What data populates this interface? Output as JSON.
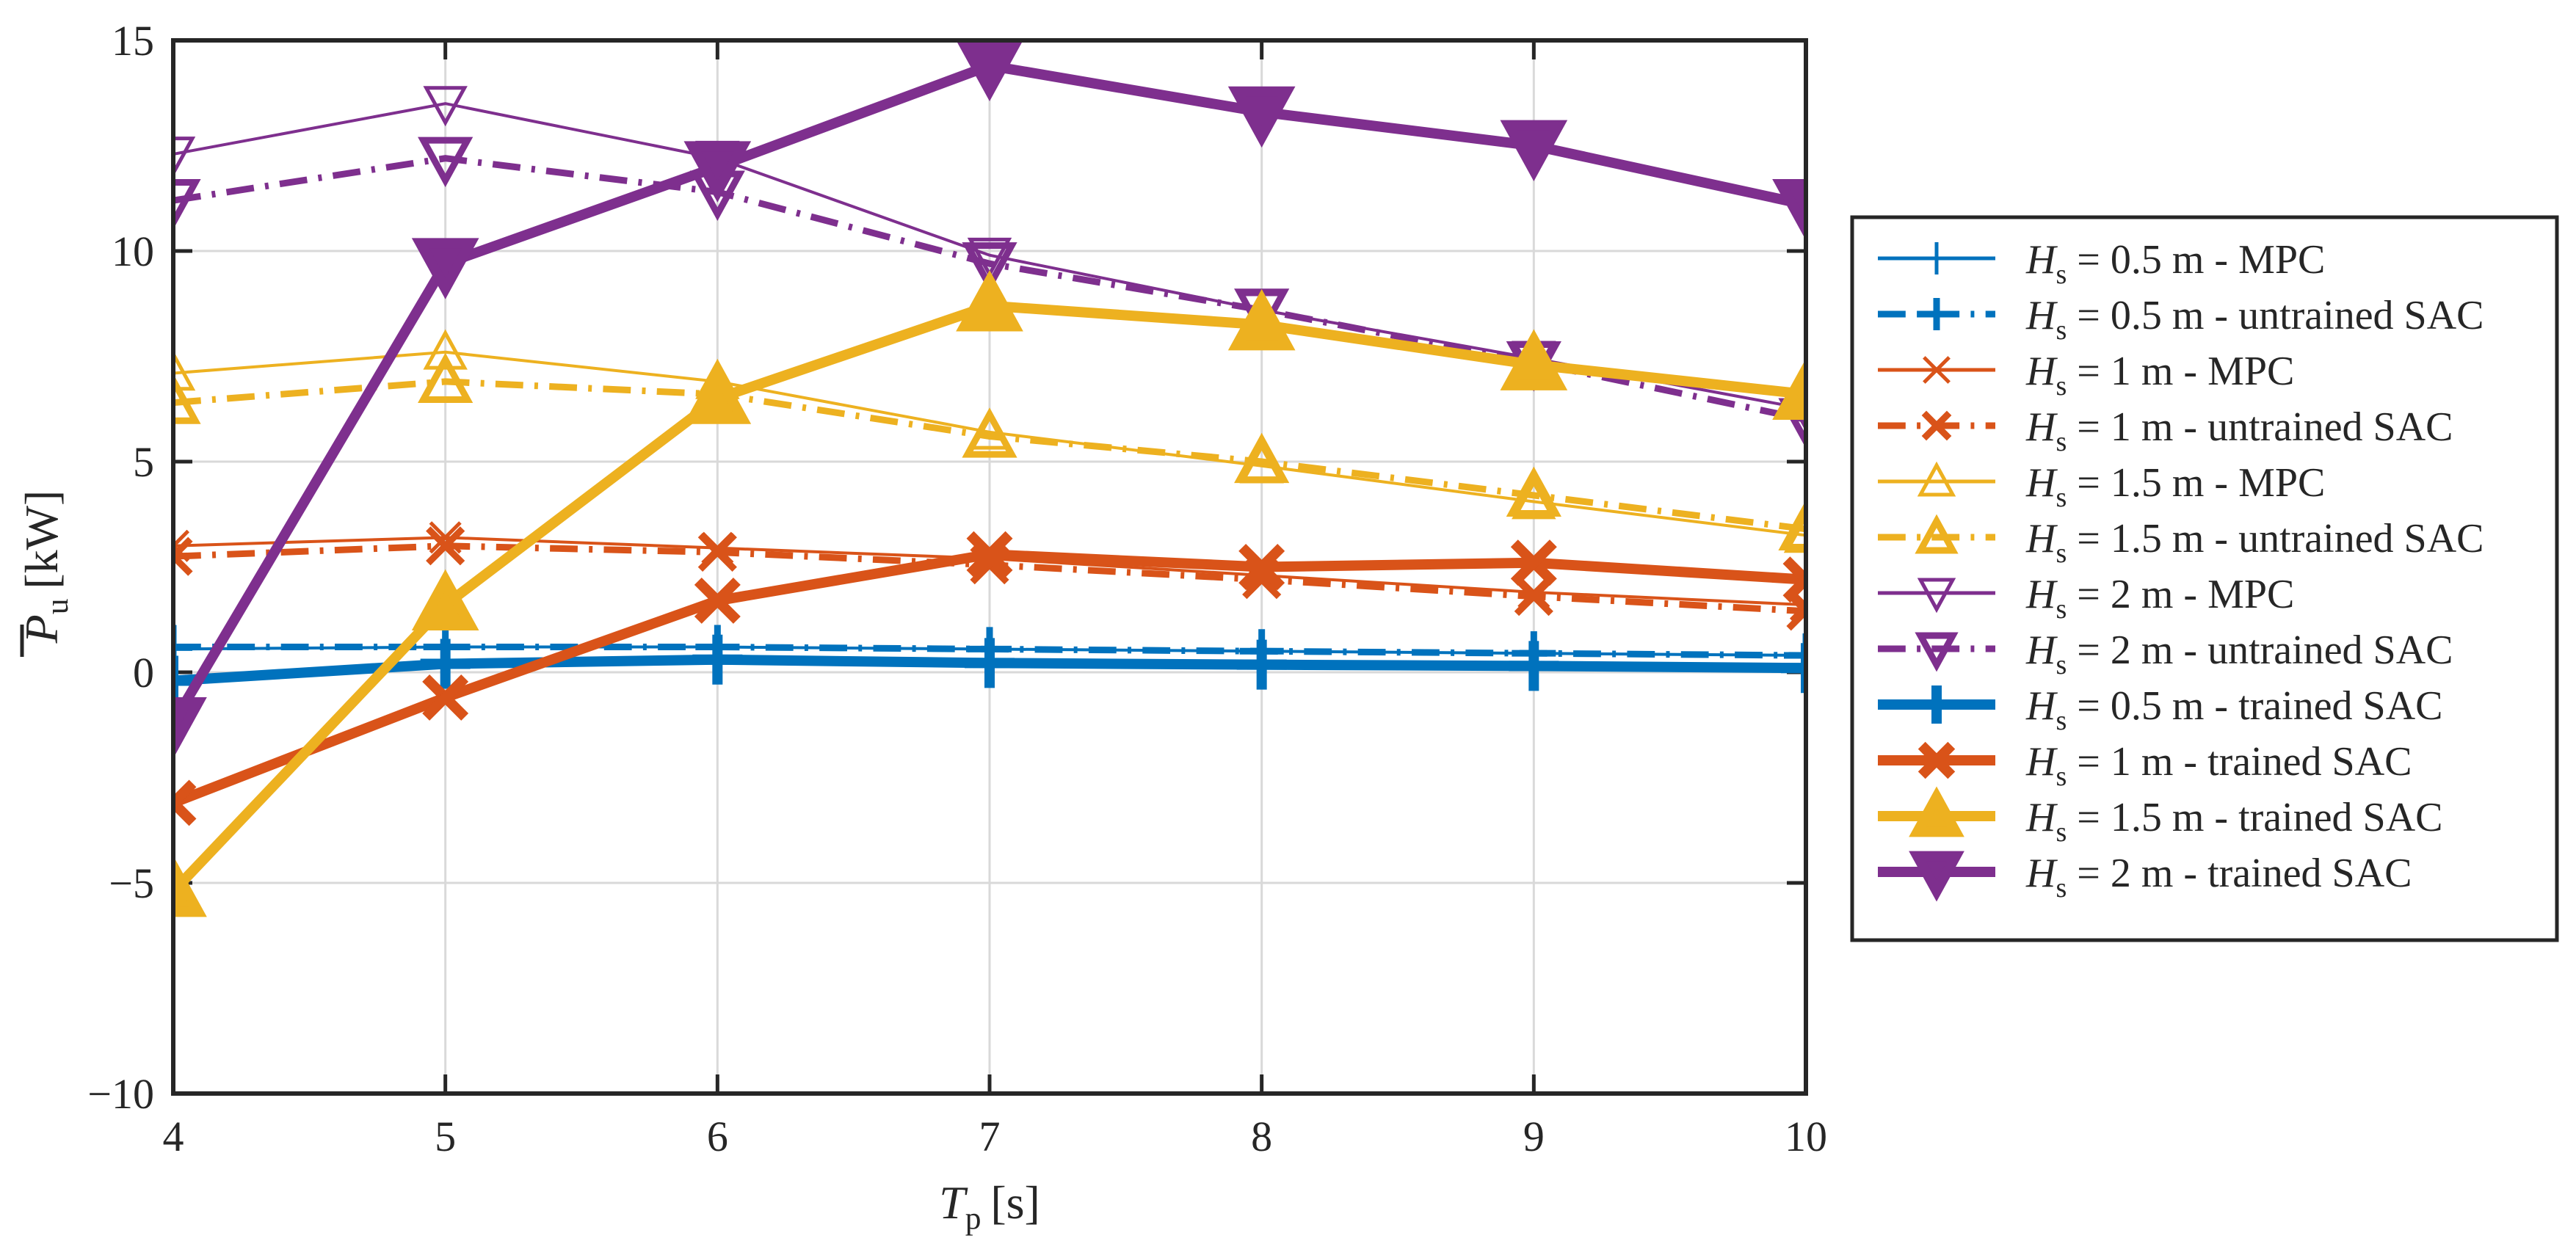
{
  "chart_data": {
    "type": "line",
    "title": "",
    "xlabel": "T_p [s]",
    "xlabel_parts": {
      "var": "T",
      "sub": "p",
      "unit": "[s]"
    },
    "ylabel": "P̄_u [kW]",
    "ylabel_parts": {
      "var": "P",
      "sub": "u",
      "unit": "[kW]",
      "overbar": true
    },
    "x": [
      4,
      5,
      6,
      7,
      8,
      9,
      10
    ],
    "xticks": [
      "4",
      "5",
      "6",
      "7",
      "8",
      "9",
      "10"
    ],
    "yticks": [
      "-10",
      "-5",
      "0",
      "5",
      "10",
      "15"
    ],
    "xlim": [
      4,
      10
    ],
    "ylim": [
      -10,
      15
    ],
    "grid": true,
    "legend_position": "right-outside",
    "colors": {
      "blue": "#0072BD",
      "orange": "#D95319",
      "yellow": "#EDB120",
      "purple": "#7E2F8E"
    },
    "series": [
      {
        "name": "H_s = 0.5 m - MPC",
        "label_parts": {
          "var": "H",
          "sub": "s",
          "rest": "= 0.5 m - MPC"
        },
        "color": "#0072BD",
        "style": "solid",
        "width": 4,
        "marker": "plus",
        "marker_filled": false,
        "values": [
          0.55,
          0.6,
          0.6,
          0.55,
          0.5,
          0.45,
          0.4
        ]
      },
      {
        "name": "H_s = 0.5 m - untrained SAC",
        "label_parts": {
          "var": "H",
          "sub": "s",
          "rest": "= 0.5 m - untrained SAC"
        },
        "color": "#0072BD",
        "style": "dashdot",
        "width": 9,
        "marker": "plus",
        "marker_filled": false,
        "values": [
          0.6,
          0.6,
          0.6,
          0.55,
          0.5,
          0.45,
          0.4
        ]
      },
      {
        "name": "H_s = 1 m - MPC",
        "label_parts": {
          "var": "H",
          "sub": "s",
          "rest": "= 1 m - MPC"
        },
        "color": "#D95319",
        "style": "solid",
        "width": 4,
        "marker": "x",
        "marker_filled": false,
        "values": [
          3.0,
          3.2,
          2.95,
          2.7,
          2.3,
          1.9,
          1.6
        ]
      },
      {
        "name": "H_s = 1 m - untrained SAC",
        "label_parts": {
          "var": "H",
          "sub": "s",
          "rest": "= 1 m - untrained SAC"
        },
        "color": "#D95319",
        "style": "dashdot",
        "width": 9,
        "marker": "x",
        "marker_filled": false,
        "values": [
          2.75,
          3.0,
          2.85,
          2.55,
          2.2,
          1.8,
          1.45
        ]
      },
      {
        "name": "H_s = 1.5 m - MPC",
        "label_parts": {
          "var": "H",
          "sub": "s",
          "rest": "= 1.5 m - MPC"
        },
        "color": "#EDB120",
        "style": "solid",
        "width": 4,
        "marker": "triangle-up",
        "marker_filled": false,
        "values": [
          7.1,
          7.6,
          6.9,
          5.7,
          4.9,
          4.05,
          3.25
        ]
      },
      {
        "name": "H_s = 1.5 m - untrained SAC",
        "label_parts": {
          "var": "H",
          "sub": "s",
          "rest": "= 1.5 m - untrained SAC"
        },
        "color": "#EDB120",
        "style": "dashdot",
        "width": 9,
        "marker": "triangle-up",
        "marker_filled": false,
        "values": [
          6.4,
          6.9,
          6.6,
          5.6,
          5.0,
          4.2,
          3.4
        ]
      },
      {
        "name": "H_s = 2 m - MPC",
        "label_parts": {
          "var": "H",
          "sub": "s",
          "rest": "= 2 m - MPC"
        },
        "color": "#7E2F8E",
        "style": "solid",
        "width": 4,
        "marker": "triangle-down",
        "marker_filled": false,
        "values": [
          12.3,
          13.5,
          12.2,
          9.9,
          8.6,
          7.45,
          6.25
        ]
      },
      {
        "name": "H_s = 2 m - untrained SAC",
        "label_parts": {
          "var": "H",
          "sub": "s",
          "rest": "= 2 m - untrained SAC"
        },
        "color": "#7E2F8E",
        "style": "dashdot",
        "width": 9,
        "marker": "triangle-down",
        "marker_filled": false,
        "values": [
          11.2,
          12.2,
          11.4,
          9.7,
          8.6,
          7.35,
          6.0
        ]
      },
      {
        "name": "H_s = 0.5 m - trained SAC",
        "label_parts": {
          "var": "H",
          "sub": "s",
          "rest": "= 0.5 m - trained SAC"
        },
        "color": "#0072BD",
        "style": "solid",
        "width": 14,
        "marker": "plus",
        "marker_filled": true,
        "values": [
          -0.2,
          0.2,
          0.3,
          0.22,
          0.18,
          0.15,
          0.1
        ]
      },
      {
        "name": "H_s = 1 m - trained SAC",
        "label_parts": {
          "var": "H",
          "sub": "s",
          "rest": "= 1 m - trained SAC"
        },
        "color": "#D95319",
        "style": "solid",
        "width": 14,
        "marker": "x",
        "marker_filled": true,
        "values": [
          -3.1,
          -0.6,
          1.7,
          2.8,
          2.5,
          2.6,
          2.2
        ]
      },
      {
        "name": "H_s = 1.5 m - trained SAC",
        "label_parts": {
          "var": "H",
          "sub": "s",
          "rest": "= 1.5 m - trained SAC"
        },
        "color": "#EDB120",
        "style": "solid",
        "width": 14,
        "marker": "triangle-up",
        "marker_filled": true,
        "values": [
          -5.2,
          1.6,
          6.5,
          8.7,
          8.25,
          7.3,
          6.6
        ]
      },
      {
        "name": "H_s = 2 m - trained SAC",
        "label_parts": {
          "var": "H",
          "sub": "s",
          "rest": "= 2 m - trained SAC"
        },
        "color": "#7E2F8E",
        "style": "solid",
        "width": 14,
        "marker": "triangle-down",
        "marker_filled": true,
        "values": [
          -1.2,
          9.7,
          12.0,
          14.4,
          13.3,
          12.5,
          11.1
        ]
      }
    ]
  }
}
